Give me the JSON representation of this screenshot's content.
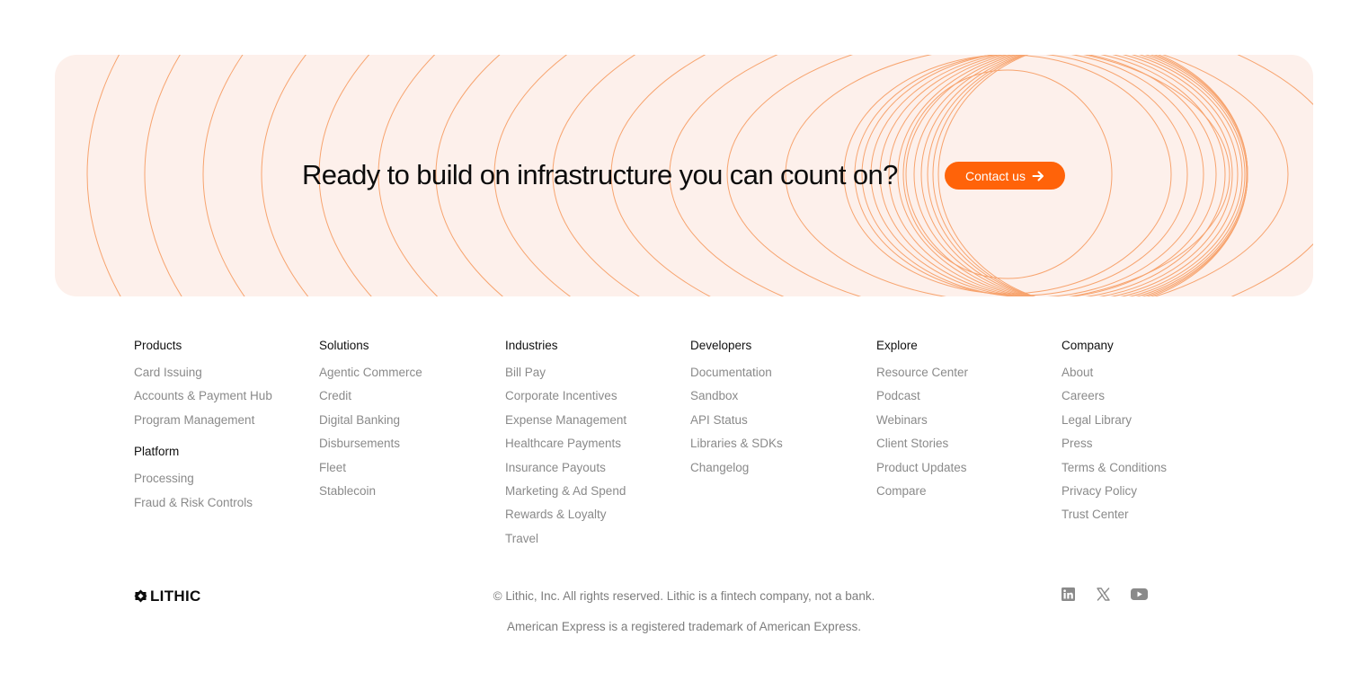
{
  "cta": {
    "title": "Ready to build on infrastructure you can count on?",
    "button_label": "Contact us",
    "button_icon": "arrow-right-icon"
  },
  "colors": {
    "accent": "#ff6309",
    "cta_background": "#fdf0eb",
    "ring_stroke": "#f7a46f",
    "link_text": "#8a8a8a",
    "heading_text": "#111111"
  },
  "footer": {
    "columns": [
      {
        "heading": "Products",
        "links": [
          "Card Issuing",
          "Accounts & Payment Hub",
          "Program Management"
        ],
        "sub_heading": "Platform",
        "sub_links": [
          "Processing",
          "Fraud & Risk Controls"
        ]
      },
      {
        "heading": "Solutions",
        "links": [
          "Agentic Commerce",
          "Credit",
          "Digital Banking",
          "Disbursements",
          "Fleet",
          "Stablecoin"
        ]
      },
      {
        "heading": "Industries",
        "links": [
          "Bill Pay",
          "Corporate Incentives",
          "Expense Management",
          "Healthcare Payments",
          "Insurance Payouts",
          "Marketing & Ad Spend",
          "Rewards & Loyalty",
          "Travel"
        ]
      },
      {
        "heading": "Developers",
        "links": [
          "Documentation",
          "Sandbox",
          "API Status",
          "Libraries & SDKs",
          "Changelog"
        ]
      },
      {
        "heading": "Explore",
        "links": [
          "Resource Center",
          "Podcast",
          "Webinars",
          "Client Stories",
          "Product Updates",
          "Compare"
        ]
      },
      {
        "heading": "Company",
        "links": [
          "About",
          "Careers",
          "Legal Library",
          "Press",
          "Terms & Conditions",
          "Privacy Policy",
          "Trust Center"
        ]
      }
    ]
  },
  "brand": {
    "logo_text": "LITHIC"
  },
  "legal": {
    "line1": "© Lithic, Inc. All rights reserved. Lithic is a fintech company, not a bank.",
    "line2": "American Express is a registered trademark of American Express."
  },
  "social": [
    {
      "name": "linkedin-icon"
    },
    {
      "name": "x-icon"
    },
    {
      "name": "youtube-icon"
    }
  ]
}
